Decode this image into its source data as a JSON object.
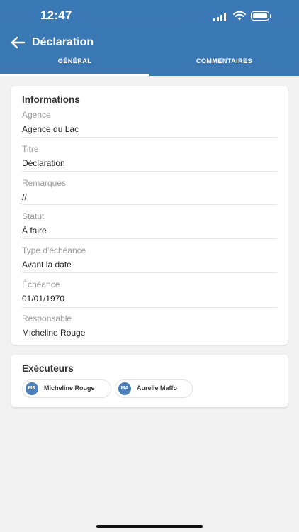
{
  "status_bar": {
    "time": "12:47"
  },
  "header": {
    "title": "Déclaration"
  },
  "tabs": [
    {
      "label": "GÉNÉRAL",
      "active": true
    },
    {
      "label": "COMMENTAIRES",
      "active": false
    }
  ],
  "info_card": {
    "title": "Informations",
    "fields": [
      {
        "label": "Agence",
        "value": "Agence du Lac"
      },
      {
        "label": "Titre",
        "value": "Déclaration"
      },
      {
        "label": "Remarques",
        "value": "//"
      },
      {
        "label": "Statut",
        "value": "À faire"
      },
      {
        "label": "Type d'échéance",
        "value": "Avant la date"
      },
      {
        "label": "Échéance",
        "value": "01/01/1970"
      },
      {
        "label": "Responsable",
        "value": "Micheline Rouge"
      }
    ]
  },
  "executors_card": {
    "title": "Exécuteurs",
    "people": [
      {
        "initials": "MR",
        "name": "Micheline Rouge"
      },
      {
        "initials": "MA",
        "name": "Aurelie Maffo"
      }
    ]
  },
  "colors": {
    "header": "#3b79b6",
    "avatar": "#4a7fb8",
    "background": "#f2f2f2"
  }
}
